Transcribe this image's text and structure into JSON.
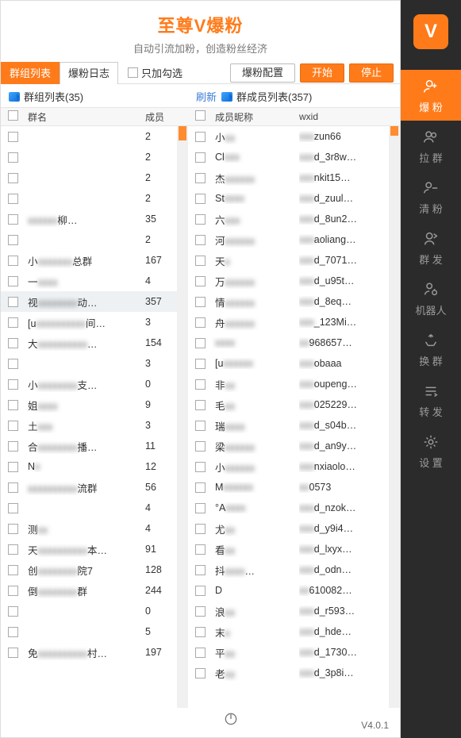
{
  "header": {
    "title": "至尊V爆粉",
    "subtitle": "自动引流加粉，创造粉丝经济"
  },
  "toolbar": {
    "tab_groups": "群组列表",
    "tab_log": "爆粉日志",
    "only_checked": "只加勾选",
    "cfg": "爆粉配置",
    "start": "开始",
    "stop": "停止"
  },
  "leftPane": {
    "title": "群组列表(35)",
    "col_name": "群名",
    "col_count": "成员",
    "rows": [
      {
        "name": "",
        "count": "2"
      },
      {
        "name": "",
        "count": "2"
      },
      {
        "name": "",
        "count": "2"
      },
      {
        "name": "",
        "count": "2"
      },
      {
        "name": "██████柳…",
        "count": "35"
      },
      {
        "name": "",
        "count": "2"
      },
      {
        "name": "小███████总群",
        "count": "167"
      },
      {
        "name": "一████",
        "count": "4"
      },
      {
        "name": "视████████动…",
        "count": "357",
        "sel": true
      },
      {
        "name": "[u██████████间…",
        "count": "3"
      },
      {
        "name": "大██████████…",
        "count": "154"
      },
      {
        "name": "",
        "count": "3"
      },
      {
        "name": "小████████支…",
        "count": "0"
      },
      {
        "name": "姐████",
        "count": "9"
      },
      {
        "name": "土███",
        "count": "3"
      },
      {
        "name": "合████████播…",
        "count": "11"
      },
      {
        "name": "N█",
        "count": "12"
      },
      {
        "name": "██████████流群",
        "count": "56"
      },
      {
        "name": "",
        "count": "4"
      },
      {
        "name": "测██",
        "count": "4"
      },
      {
        "name": "天██████████本…",
        "count": "91"
      },
      {
        "name": "创████████院7",
        "count": "128"
      },
      {
        "name": "倒████████群",
        "count": "244"
      },
      {
        "name": "",
        "count": "0"
      },
      {
        "name": "",
        "count": "5"
      },
      {
        "name": "免██████████村…",
        "count": "197"
      }
    ]
  },
  "rightPane": {
    "refresh": "刷新",
    "title": "群成员列表(357)",
    "col_nick": "成员昵称",
    "col_id": "wxid",
    "rows": [
      {
        "nick": "小██",
        "id": "███zun66"
      },
      {
        "nick": "Cl███",
        "id": "███d_3r8w…"
      },
      {
        "nick": "杰██████",
        "id": "███nkit15…"
      },
      {
        "nick": "St████",
        "id": "███d_zuul…"
      },
      {
        "nick": "六███",
        "id": "███d_8un2…"
      },
      {
        "nick": "河██████",
        "id": "███aoliang…"
      },
      {
        "nick": "天█",
        "id": "███d_7071…"
      },
      {
        "nick": "万██████",
        "id": "███d_u95t…"
      },
      {
        "nick": "情██████",
        "id": "███d_8eq…"
      },
      {
        "nick": "舟██████",
        "id": "███_123Mi…"
      },
      {
        "nick": "████",
        "id": "██968657…"
      },
      {
        "nick": "[u██████",
        "id": "███obaaa"
      },
      {
        "nick": "非██",
        "id": "███oupeng…"
      },
      {
        "nick": "毛██",
        "id": "███025229…"
      },
      {
        "nick": "瑞████",
        "id": "███d_s04b…"
      },
      {
        "nick": "梁██████",
        "id": "███d_an9y…"
      },
      {
        "nick": "小██████",
        "id": "███nxiaolo…"
      },
      {
        "nick": "M██████",
        "id": "██0573"
      },
      {
        "nick": "°A████",
        "id": "███d_nzok…"
      },
      {
        "nick": "尤██",
        "id": "███d_y9i4…"
      },
      {
        "nick": "看██",
        "id": "███d_lxyx…"
      },
      {
        "nick": "抖████…",
        "id": "███d_odn…"
      },
      {
        "nick": "D",
        "id": "██610082…"
      },
      {
        "nick": "浪██",
        "id": "███d_r593…"
      },
      {
        "nick": "末█",
        "id": "███d_hde…"
      },
      {
        "nick": "平██",
        "id": "███d_1730…"
      },
      {
        "nick": "老██",
        "id": "███d_3p8i…"
      }
    ]
  },
  "sidebar": {
    "items": [
      {
        "label": "爆 粉",
        "icon": "person-plus",
        "active": true
      },
      {
        "label": "拉 群",
        "icon": "people"
      },
      {
        "label": "清 粉",
        "icon": "people-minus"
      },
      {
        "label": "群 发",
        "icon": "broadcast"
      },
      {
        "label": "机器人",
        "icon": "robot"
      },
      {
        "label": "换 群",
        "icon": "shuffle"
      },
      {
        "label": "转 发",
        "icon": "forward"
      },
      {
        "label": "设 置",
        "icon": "gear"
      }
    ]
  },
  "footer": {
    "version": "V4.0.1"
  }
}
